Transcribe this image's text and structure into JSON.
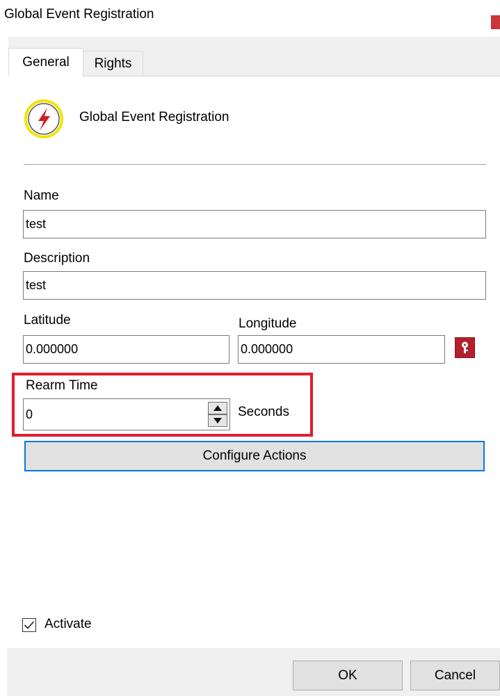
{
  "window": {
    "title": "Global Event Registration"
  },
  "tabs": [
    {
      "label": "General",
      "active": true
    },
    {
      "label": "Rights",
      "active": false
    }
  ],
  "header": {
    "title": "Global Event Registration",
    "icon": "lightning-icon"
  },
  "form": {
    "name": {
      "label": "Name",
      "value": "test"
    },
    "description": {
      "label": "Description",
      "value": "test"
    },
    "latitude": {
      "label": "Latitude",
      "value": "0.000000"
    },
    "longitude": {
      "label": "Longitude",
      "value": "0.000000"
    },
    "location_button": {
      "icon": "key-icon"
    },
    "rearm_time": {
      "label": "Rearm Time",
      "value": "0",
      "unit": "Seconds"
    },
    "configure_actions_label": "Configure Actions",
    "activate": {
      "label": "Activate",
      "checked": true
    }
  },
  "footer": {
    "ok_label": "OK",
    "cancel_label": "Cancel"
  },
  "colors": {
    "accent": "#0a78d7",
    "highlight": "#e31c2e",
    "key_button": "#b3202c",
    "icon_ring": "#f2e500"
  }
}
